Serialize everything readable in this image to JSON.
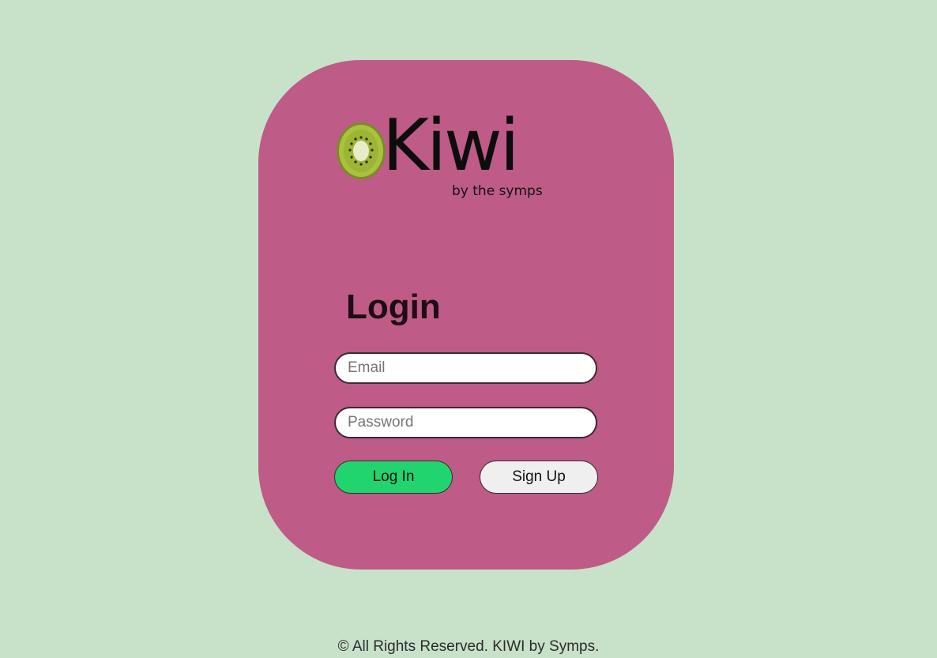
{
  "brand": {
    "logo_word": "Kiwi",
    "logo_tagline": "by the symps"
  },
  "login": {
    "title": "Login",
    "email_placeholder": "Email",
    "password_placeholder": "Password",
    "login_button": "Log In",
    "signup_button": "Sign Up"
  },
  "footer": {
    "text": "© All Rights Reserved. KIWI by Symps."
  },
  "colors": {
    "background": "#c8e2ca",
    "card": "#be5b87",
    "login_button": "#22d46d",
    "signup_button": "#efefef"
  }
}
